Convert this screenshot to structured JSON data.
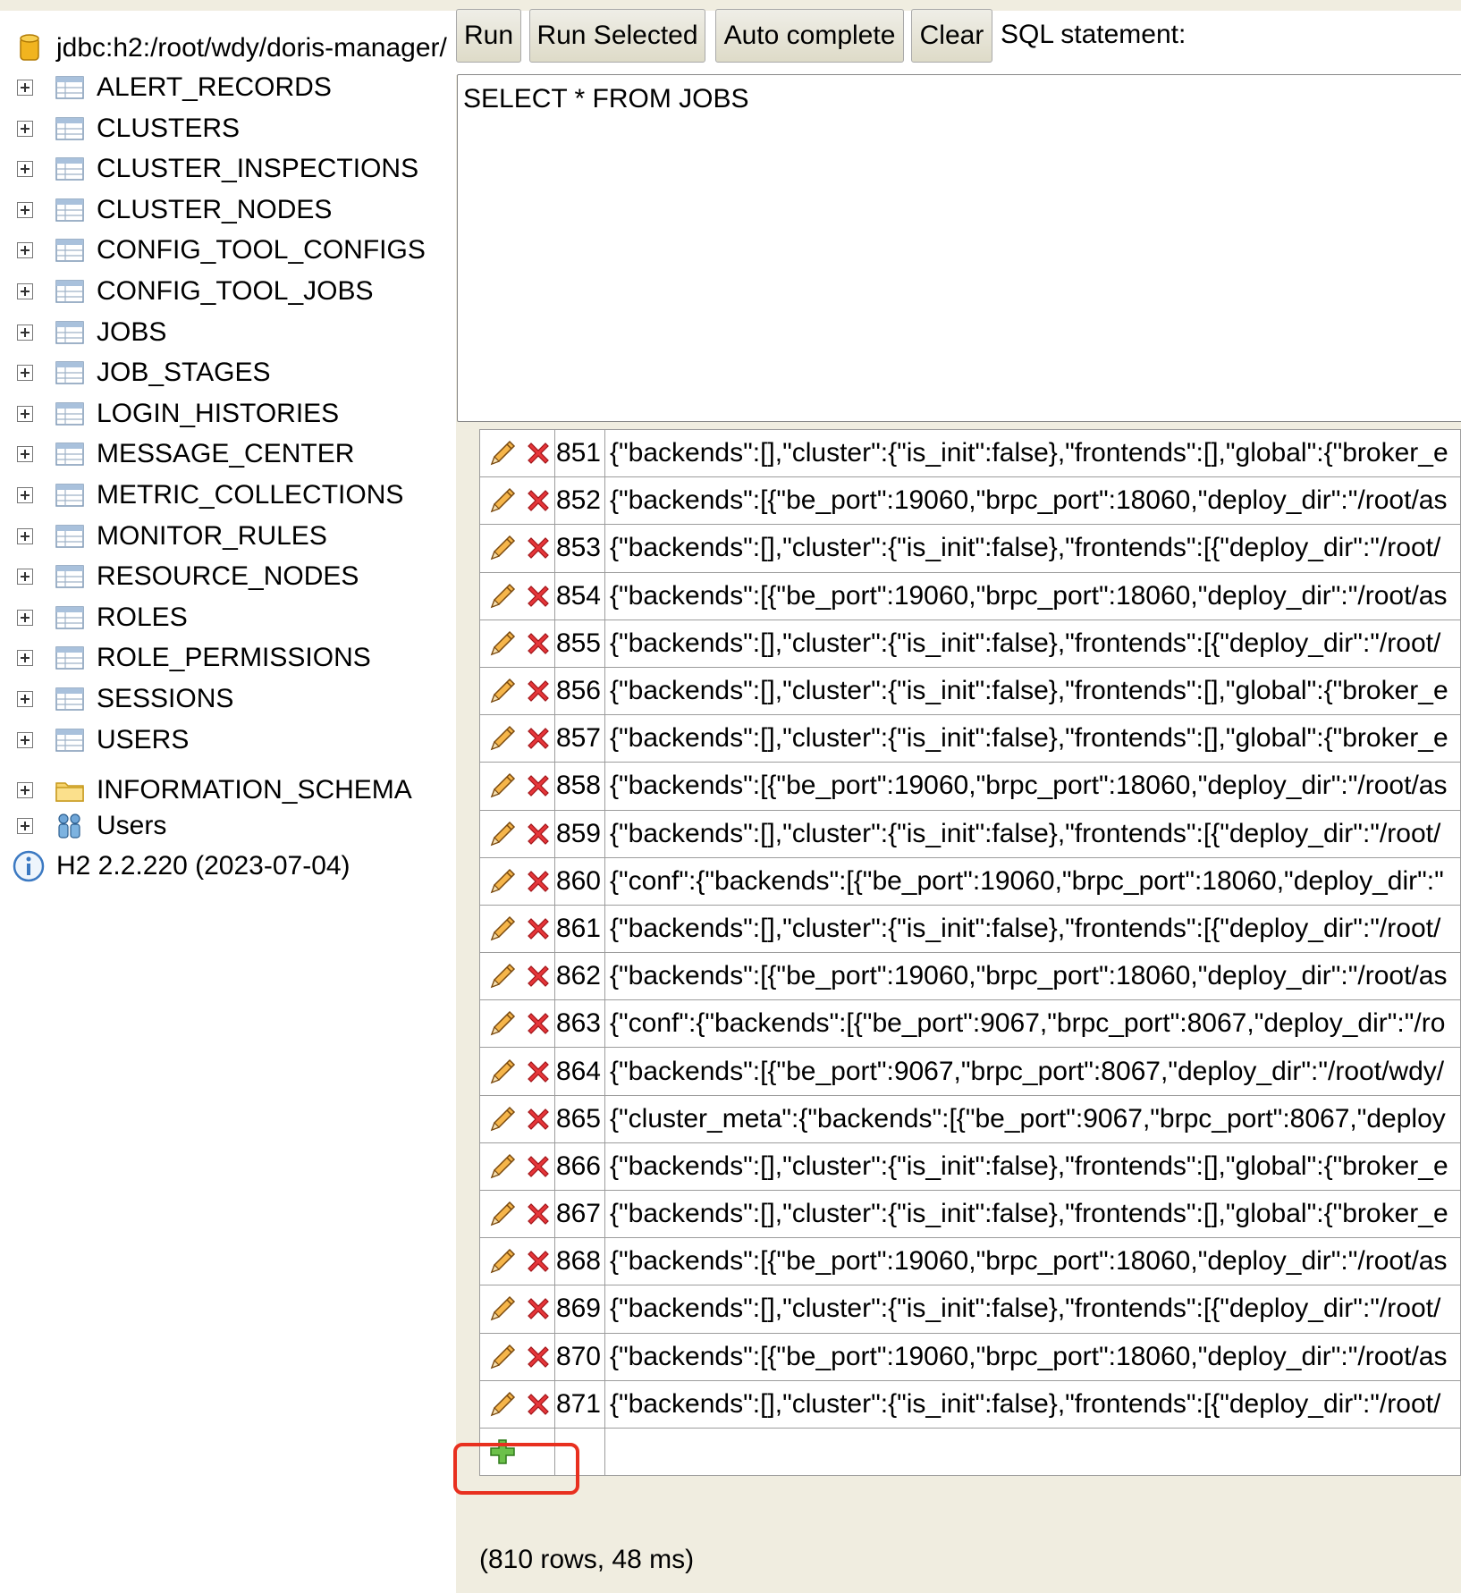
{
  "connection": {
    "url": "jdbc:h2:/root/wdy/doris-manager/"
  },
  "tables": [
    "ALERT_RECORDS",
    "CLUSTERS",
    "CLUSTER_INSPECTIONS",
    "CLUSTER_NODES",
    "CONFIG_TOOL_CONFIGS",
    "CONFIG_TOOL_JOBS",
    "JOBS",
    "JOB_STAGES",
    "LOGIN_HISTORIES",
    "MESSAGE_CENTER",
    "METRIC_COLLECTIONS",
    "MONITOR_RULES",
    "RESOURCE_NODES",
    "ROLES",
    "ROLE_PERMISSIONS",
    "SESSIONS",
    "USERS"
  ],
  "schema_folder": "INFORMATION_SCHEMA",
  "users_node": "Users",
  "version": "H2 2.2.220 (2023-07-04)",
  "toolbar": {
    "run": "Run",
    "run_selected": "Run Selected",
    "auto_complete": "Auto complete",
    "clear": "Clear",
    "caption": "SQL statement:"
  },
  "editor": {
    "sql": "SELECT * FROM JOBS"
  },
  "rows": [
    {
      "id": "851",
      "value": "{\"backends\":[],\"cluster\":{\"is_init\":false},\"frontends\":[],\"global\":{\"broker_e"
    },
    {
      "id": "852",
      "value": "{\"backends\":[{\"be_port\":19060,\"brpc_port\":18060,\"deploy_dir\":\"/root/as"
    },
    {
      "id": "853",
      "value": "{\"backends\":[],\"cluster\":{\"is_init\":false},\"frontends\":[{\"deploy_dir\":\"/root/"
    },
    {
      "id": "854",
      "value": "{\"backends\":[{\"be_port\":19060,\"brpc_port\":18060,\"deploy_dir\":\"/root/as"
    },
    {
      "id": "855",
      "value": "{\"backends\":[],\"cluster\":{\"is_init\":false},\"frontends\":[{\"deploy_dir\":\"/root/"
    },
    {
      "id": "856",
      "value": "{\"backends\":[],\"cluster\":{\"is_init\":false},\"frontends\":[],\"global\":{\"broker_e"
    },
    {
      "id": "857",
      "value": "{\"backends\":[],\"cluster\":{\"is_init\":false},\"frontends\":[],\"global\":{\"broker_e"
    },
    {
      "id": "858",
      "value": "{\"backends\":[{\"be_port\":19060,\"brpc_port\":18060,\"deploy_dir\":\"/root/as"
    },
    {
      "id": "859",
      "value": "{\"backends\":[],\"cluster\":{\"is_init\":false},\"frontends\":[{\"deploy_dir\":\"/root/"
    },
    {
      "id": "860",
      "value": "{\"conf\":{\"backends\":[{\"be_port\":19060,\"brpc_port\":18060,\"deploy_dir\":\""
    },
    {
      "id": "861",
      "value": "{\"backends\":[],\"cluster\":{\"is_init\":false},\"frontends\":[{\"deploy_dir\":\"/root/"
    },
    {
      "id": "862",
      "value": "{\"backends\":[{\"be_port\":19060,\"brpc_port\":18060,\"deploy_dir\":\"/root/as"
    },
    {
      "id": "863",
      "value": "{\"conf\":{\"backends\":[{\"be_port\":9067,\"brpc_port\":8067,\"deploy_dir\":\"/ro"
    },
    {
      "id": "864",
      "value": "{\"backends\":[{\"be_port\":9067,\"brpc_port\":8067,\"deploy_dir\":\"/root/wdy/"
    },
    {
      "id": "865",
      "value": "{\"cluster_meta\":{\"backends\":[{\"be_port\":9067,\"brpc_port\":8067,\"deploy"
    },
    {
      "id": "866",
      "value": "{\"backends\":[],\"cluster\":{\"is_init\":false},\"frontends\":[],\"global\":{\"broker_e"
    },
    {
      "id": "867",
      "value": "{\"backends\":[],\"cluster\":{\"is_init\":false},\"frontends\":[],\"global\":{\"broker_e"
    },
    {
      "id": "868",
      "value": "{\"backends\":[{\"be_port\":19060,\"brpc_port\":18060,\"deploy_dir\":\"/root/as"
    },
    {
      "id": "869",
      "value": "{\"backends\":[],\"cluster\":{\"is_init\":false},\"frontends\":[{\"deploy_dir\":\"/root/"
    },
    {
      "id": "870",
      "value": "{\"backends\":[{\"be_port\":19060,\"brpc_port\":18060,\"deploy_dir\":\"/root/as"
    },
    {
      "id": "871",
      "value": "{\"backends\":[],\"cluster\":{\"is_init\":false},\"frontends\":[{\"deploy_dir\":\"/root/"
    }
  ],
  "footer": "(810 rows, 48 ms)",
  "colors": {
    "highlight": "#e8301f",
    "background": "#f0ede0"
  },
  "icons": {
    "db": "database-icon",
    "table": "table-icon",
    "folder": "folder-icon",
    "users": "users-icon",
    "info": "info-icon",
    "edit": "pencil-icon",
    "delete": "delete-icon",
    "add": "add-row-icon",
    "expand": "expand-plus-icon"
  }
}
